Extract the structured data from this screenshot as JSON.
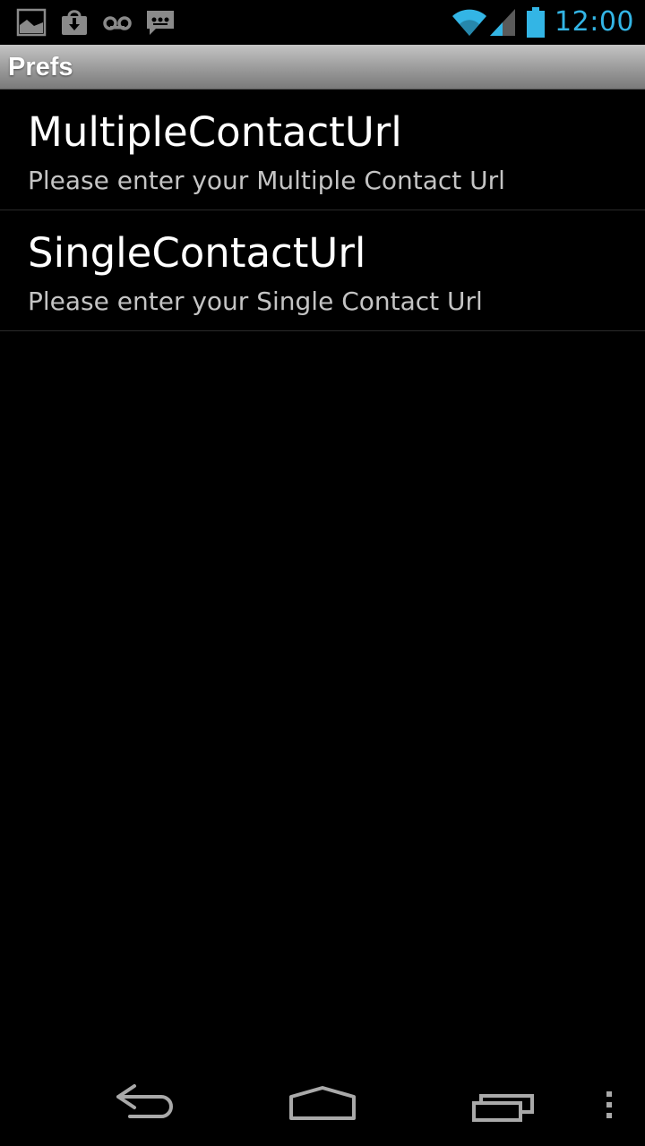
{
  "status_bar": {
    "time": "12:00",
    "left_icons": [
      "gallery-icon",
      "download-icon",
      "voicemail-icon",
      "message-icon"
    ],
    "right_icons": [
      "wifi-icon",
      "signal-icon",
      "battery-icon"
    ],
    "accent_color": "#33b5e5"
  },
  "title_bar": {
    "title": "Prefs"
  },
  "preferences": [
    {
      "title": "MultipleContactUrl",
      "summary": "Please enter your Multiple Contact Url"
    },
    {
      "title": "SingleContactUrl",
      "summary": "Please enter your Single Contact Url"
    }
  ],
  "nav_bar": {
    "buttons": [
      "back-icon",
      "home-icon",
      "recents-icon",
      "menu-icon"
    ]
  }
}
